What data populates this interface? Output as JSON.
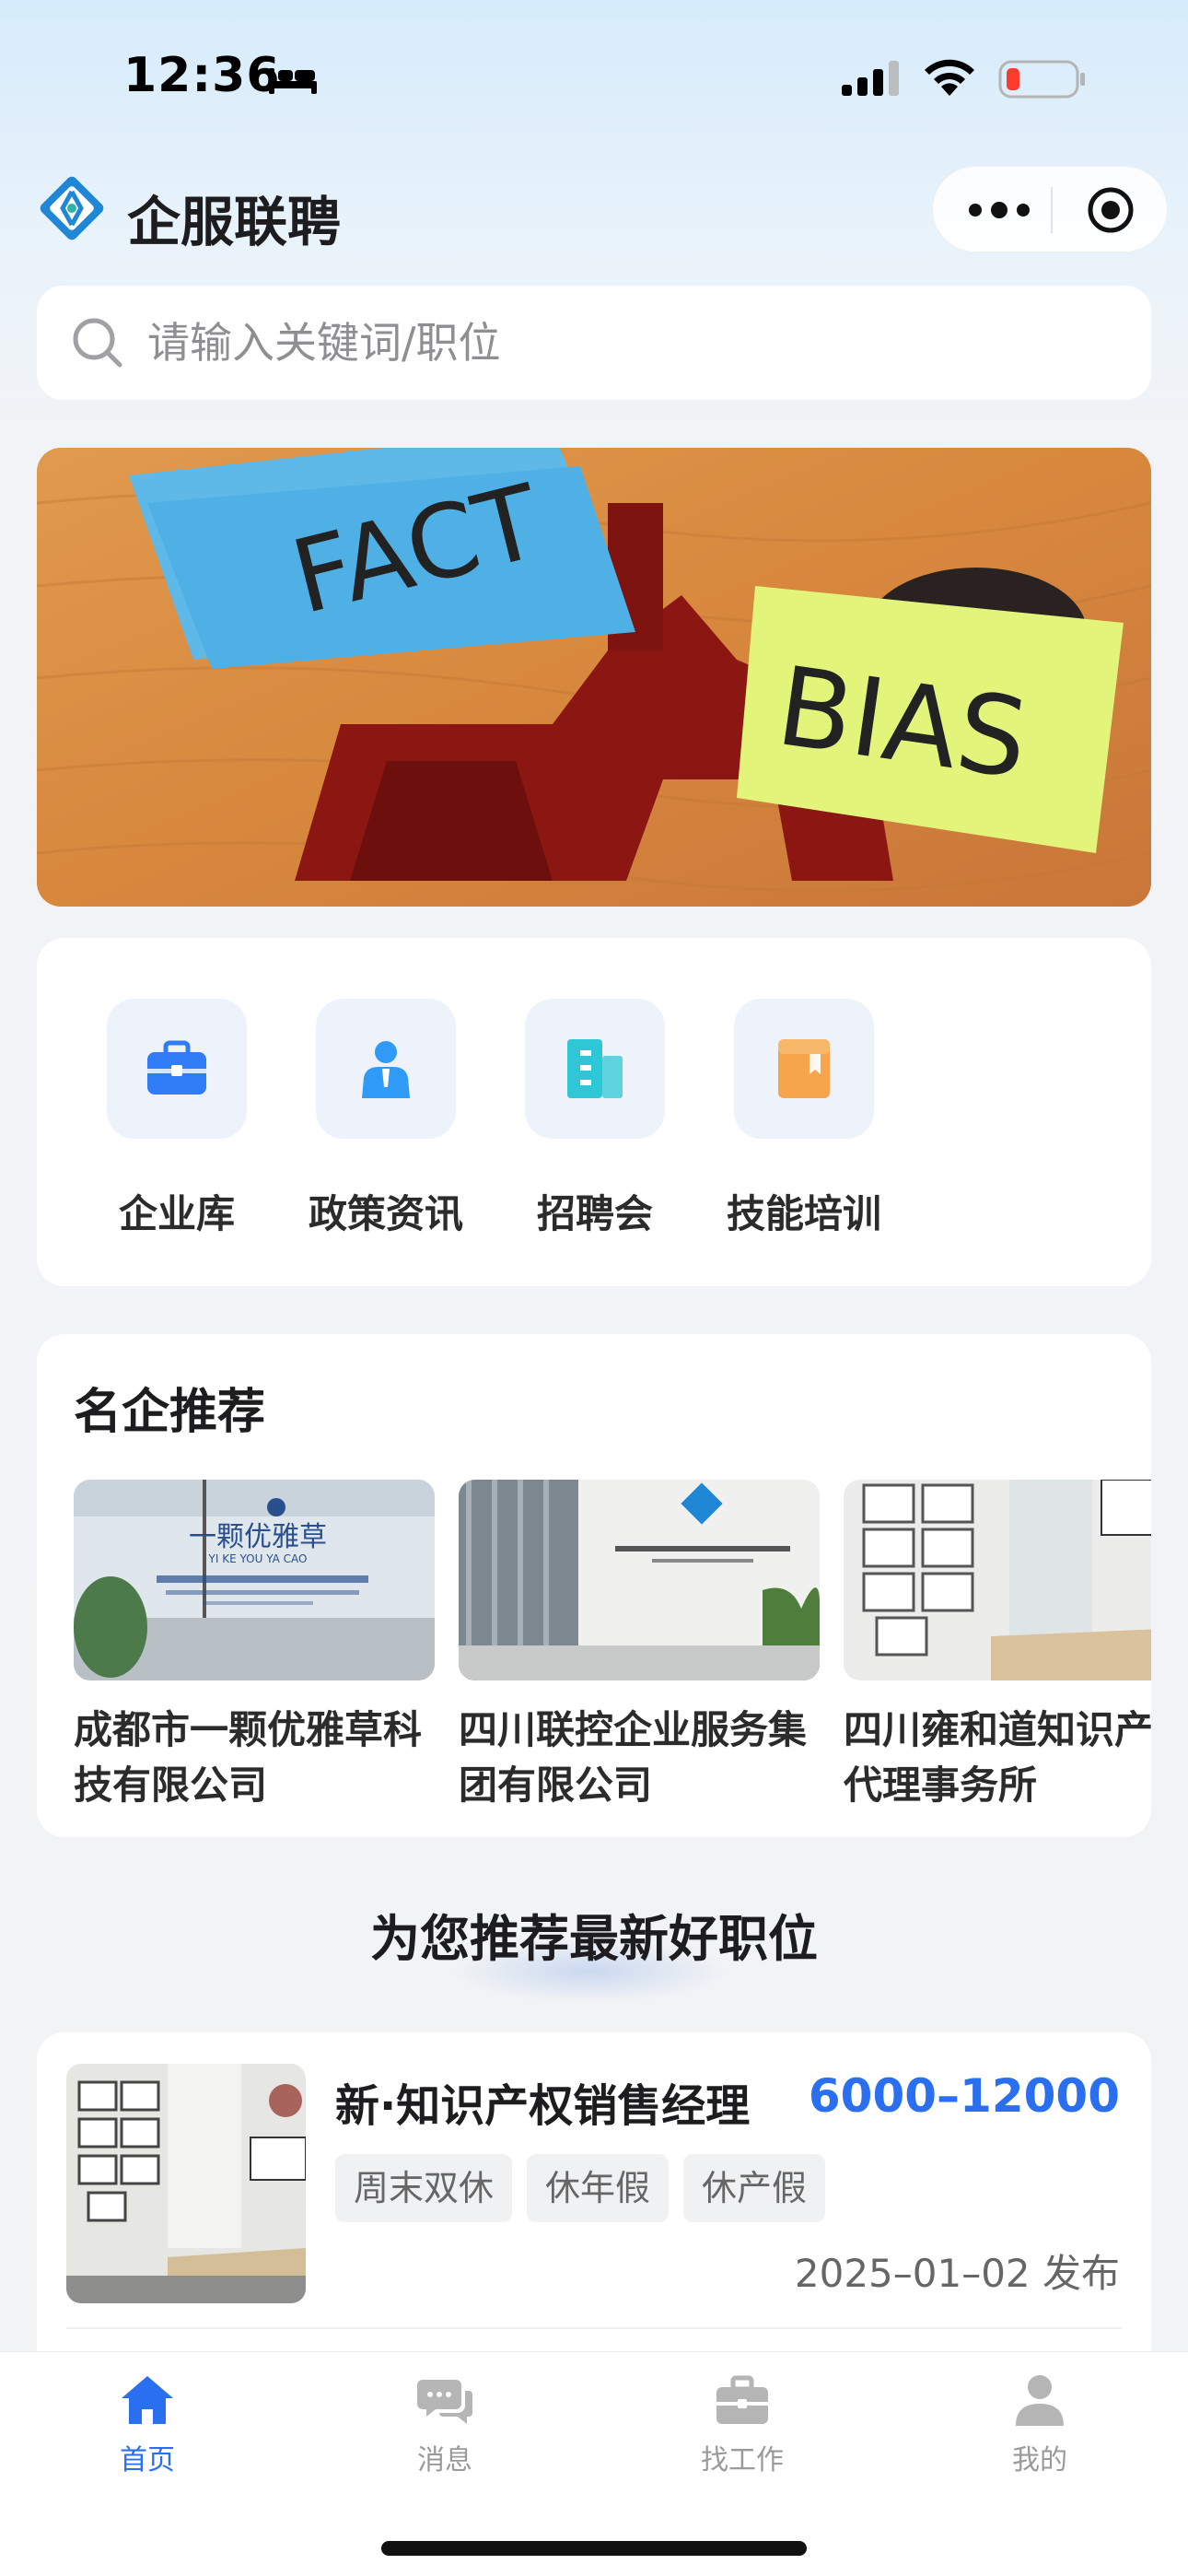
{
  "status_bar": {
    "time": "12:36",
    "icons": [
      "bed-icon",
      "signal-icon",
      "wifi-icon",
      "battery-low-icon"
    ],
    "battery_color": "#ff3b30"
  },
  "header": {
    "app_title": "企服联聘",
    "logo_icon": "company-logo-icon",
    "capsule_icons": [
      "more-dots-icon",
      "target-icon"
    ]
  },
  "search": {
    "placeholder": "请输入关键词/职位",
    "icon": "search-icon"
  },
  "banner": {
    "sticky_note_left": "FACT",
    "sticky_note_right": "BIAS"
  },
  "quick_nav": [
    {
      "label": "企业库",
      "icon": "briefcase-icon",
      "color": "#2f7cf6"
    },
    {
      "label": "政策资讯",
      "icon": "person-icon",
      "color": "#2f9bf6"
    },
    {
      "label": "招聘会",
      "icon": "building-icon",
      "color": "#2ec7d6"
    },
    {
      "label": "技能培训",
      "icon": "book-icon",
      "color": "#f7a54a"
    }
  ],
  "featured": {
    "title": "名企推荐",
    "companies": [
      {
        "name": "成都市一颗优雅草科技有限公司",
        "photo_sign": "一颗优雅草",
        "photo_subtitle": "YI KE YOU YA CAO"
      },
      {
        "name": "四川联控企业服务集团有限公司"
      },
      {
        "name": "四川雍和道知识产权代理事务所"
      }
    ]
  },
  "recommend_heading": "为您推荐最新好职位",
  "jobs": [
    {
      "title": "新·知识产权销售经理",
      "salary": "6000–12000",
      "tags": [
        "周末双休",
        "休年假",
        "休产假"
      ],
      "date": "2025–01–02 发布"
    }
  ],
  "tab_bar": {
    "accent_color": "#2a6ff0",
    "inactive_color": "#9a9a9a",
    "tabs": [
      {
        "label": "首页",
        "icon": "home-icon",
        "active": true
      },
      {
        "label": "消息",
        "icon": "chat-icon",
        "active": false
      },
      {
        "label": "找工作",
        "icon": "briefcase-icon",
        "active": false
      },
      {
        "label": "我的",
        "icon": "user-icon",
        "active": false
      }
    ]
  }
}
